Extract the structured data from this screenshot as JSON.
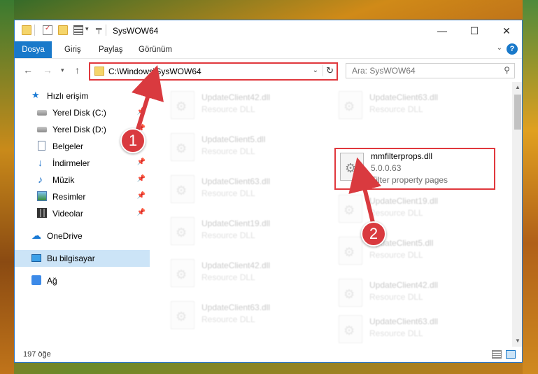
{
  "titlebar": {
    "title": "SysWOW64",
    "minimize_icon": "minimize-icon",
    "maximize_icon": "maximize-icon",
    "close_icon": "close-icon"
  },
  "ribbon": {
    "tabs": [
      {
        "label": "Dosya",
        "active": true
      },
      {
        "label": "Giriş",
        "active": false
      },
      {
        "label": "Paylaş",
        "active": false
      },
      {
        "label": "Görünüm",
        "active": false
      }
    ],
    "help_label": "?"
  },
  "address": {
    "path": "C:\\Windows\\SysWOW64",
    "search_placeholder": "Ara: SysWOW64"
  },
  "navpane": {
    "items": [
      {
        "label": "Hızlı erişim",
        "icon": "star-icon"
      },
      {
        "label": "Yerel Disk (C:)",
        "icon": "disk-icon",
        "pinned": true
      },
      {
        "label": "Yerel Disk (D:)",
        "icon": "disk-icon",
        "pinned": true
      },
      {
        "label": "Belgeler",
        "icon": "document-icon",
        "pinned": true
      },
      {
        "label": "İndirmeler",
        "icon": "download-icon",
        "pinned": true
      },
      {
        "label": "Müzik",
        "icon": "music-icon",
        "pinned": true
      },
      {
        "label": "Resimler",
        "icon": "picture-icon",
        "pinned": true
      },
      {
        "label": "Videolar",
        "icon": "video-icon",
        "pinned": true
      },
      {
        "label": "OneDrive",
        "icon": "cloud-icon"
      },
      {
        "label": "Bu bilgisayar",
        "icon": "computer-icon",
        "selected": true
      },
      {
        "label": "Ağ",
        "icon": "network-icon"
      }
    ]
  },
  "files": {
    "col1": [
      {
        "name": "UpdateClient42.dll",
        "desc": "Resource DLL"
      },
      {
        "name": "UpdateClient5.dll",
        "desc": "Resource DLL"
      },
      {
        "name": "UpdateClient63.dll",
        "desc": "Resource DLL"
      },
      {
        "name": "UpdateClient19.dll",
        "desc": "Resource DLL"
      },
      {
        "name": "UpdateClient42.dll",
        "desc": "Resource DLL"
      },
      {
        "name": "UpdateClient63.dll",
        "desc": "Resource DLL"
      }
    ],
    "col2": [
      {
        "name": "UpdateClient63.dll",
        "desc": "Resource DLL"
      },
      {
        "name": "UpdateClient19.dll",
        "desc": "Resource DLL"
      },
      {
        "name": "UpdateClient5.dll",
        "desc": "Resource DLL"
      },
      {
        "name": "UpdateClient42.dll",
        "desc": "Resource DLL"
      },
      {
        "name": "UpdateClient63.dll",
        "desc": "Resource DLL"
      }
    ],
    "highlighted": {
      "name": "mmfilterprops.dll",
      "version": "5.0.0.63",
      "desc": "Filter property pages"
    }
  },
  "status": {
    "count_text": "197 öğe"
  },
  "callouts": {
    "one": "1",
    "two": "2"
  },
  "colors": {
    "accent": "#1979ca",
    "highlight": "#e0383d",
    "callout": "#d93a3f"
  }
}
